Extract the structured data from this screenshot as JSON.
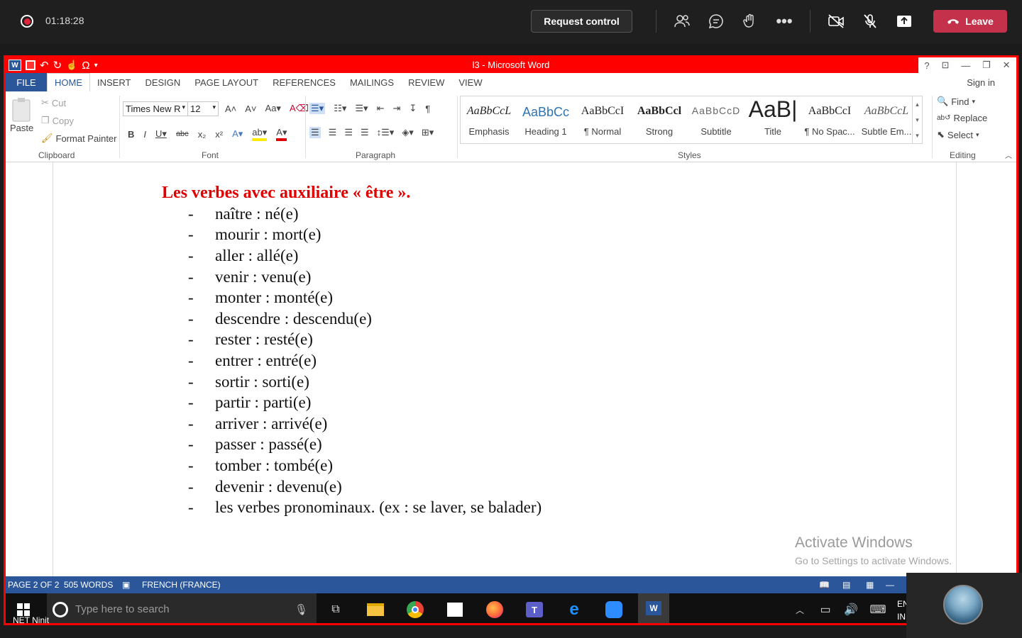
{
  "teams": {
    "timer": "01:18:28",
    "request_control": "Request control",
    "leave": "Leave",
    "participant_name": "NET Ninit"
  },
  "word": {
    "title": "l3  -  Microsoft Word",
    "tabs": [
      "FILE",
      "HOME",
      "INSERT",
      "DESIGN",
      "PAGE LAYOUT",
      "REFERENCES",
      "MAILINGS",
      "REVIEW",
      "VIEW"
    ],
    "sign_in": "Sign in",
    "clipboard": {
      "paste": "Paste",
      "cut": "Cut",
      "copy": "Copy",
      "format_painter": "Format Painter",
      "label": "Clipboard"
    },
    "font": {
      "name": "Times New R",
      "size": "12",
      "label": "Font"
    },
    "paragraph_label": "Paragraph",
    "styles": [
      {
        "sample": "AaBbCcL",
        "name": "Emphasis"
      },
      {
        "sample": "AaBbCc",
        "name": "Heading 1"
      },
      {
        "sample": "AaBbCcI",
        "name": "¶ Normal"
      },
      {
        "sample": "AaBbCcl",
        "name": "Strong"
      },
      {
        "sample": "AaBbCcD",
        "name": "Subtitle"
      },
      {
        "sample": "AaB|",
        "name": "Title"
      },
      {
        "sample": "AaBbCcI",
        "name": "¶ No Spac..."
      },
      {
        "sample": "AaBbCcL",
        "name": "Subtle Em..."
      }
    ],
    "styles_label": "Styles",
    "editing": {
      "find": "Find",
      "replace": "Replace",
      "select": "Select",
      "label": "Editing"
    }
  },
  "document": {
    "heading": "Les verbes avec auxiliaire « être ».",
    "bullet": "-",
    "items": [
      "naître : né(e)",
      "mourir : mort(e)",
      "aller : allé(e)",
      "venir : venu(e)",
      "monter : monté(e)",
      "descendre : descendu(e)",
      "rester : resté(e)",
      "entrer : entré(e)",
      "sortir : sorti(e)",
      "partir : parti(e)",
      "arriver : arrivé(e)",
      "passer : passé(e)",
      "tomber : tombé(e)",
      "devenir : devenu(e)",
      "les verbes pronominaux. (ex : se laver, se balader)"
    ]
  },
  "watermark": {
    "line1": "Activate Windows",
    "line2": "Go to Settings to activate Windows."
  },
  "status": {
    "page": "PAGE 2 OF 2",
    "words": "505 WORDS",
    "language": "FRENCH (FRANCE)"
  },
  "taskbar": {
    "search_placeholder": "Type here to search",
    "lang_top": "EN",
    "lang_bottom": "IN"
  },
  "colors": {
    "teams_leave": "#c4314b",
    "word_blue": "#2b579a",
    "share_border": "#ff0000",
    "heading_red": "#e00000"
  }
}
